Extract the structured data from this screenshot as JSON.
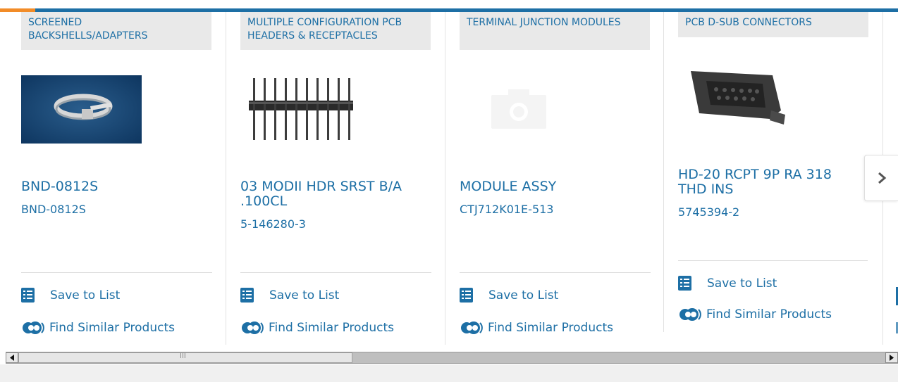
{
  "colors": {
    "brand": "#1d6fa5",
    "accent": "#f28c28",
    "category_bg": "#e9e9e9"
  },
  "cards": [
    {
      "category": "SCREENED BACKSHELLS/ADAPTERS",
      "title": "BND-0812S",
      "part_number": "BND-0812S",
      "save_label": "Save to List",
      "similar_label": "Find Similar Products",
      "image": "band-clamp-photo"
    },
    {
      "category": "MULTIPLE CONFIGURATION PCB HEADERS & RECEPTACLES",
      "title": "03 MODII HDR SRST B/A .100CL",
      "part_number": "5-146280-3",
      "save_label": "Save to List",
      "similar_label": "Find Similar Products",
      "image": "pin-header-photo"
    },
    {
      "category": "TERMINAL JUNCTION MODULES",
      "title": "MODULE ASSY",
      "part_number": "CTJ712K01E-513",
      "save_label": "Save to List",
      "similar_label": "Find Similar Products",
      "image": "camera-placeholder-icon"
    },
    {
      "category": "PCB D-SUB CONNECTORS",
      "title": "HD-20 RCPT 9P RA 318 THD INS",
      "part_number": "5745394-2",
      "save_label": "Save to List",
      "similar_label": "Find Similar Products",
      "image": "dsub-connector-photo"
    }
  ],
  "next_icon": "chevron-right-icon",
  "scrollbar": {
    "grip": "III"
  }
}
